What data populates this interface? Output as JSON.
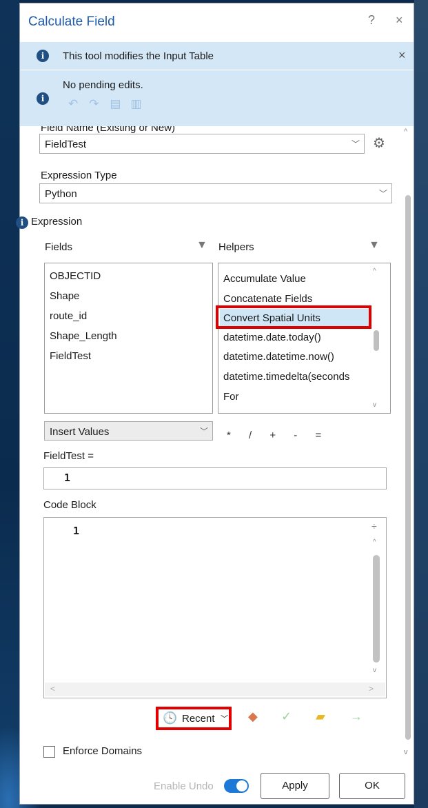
{
  "dialog": {
    "title": "Calculate Field",
    "help": "?",
    "close": "×"
  },
  "info": {
    "message": "This tool modifies the Input Table",
    "close": "×",
    "pending": "No pending edits."
  },
  "field_name": {
    "label": "Field Name (Existing or New)",
    "value": "FieldTest"
  },
  "expression_type": {
    "label": "Expression Type",
    "value": "Python"
  },
  "expression": {
    "label": "Expression",
    "fields_label": "Fields",
    "helpers_label": "Helpers",
    "fields": [
      "OBJECTID",
      "Shape",
      "route_id",
      "Shape_Length",
      "FieldTest"
    ],
    "helpers": [
      "Accumulate Value",
      "Concatenate Fields",
      "Convert Spatial Units",
      "datetime.date.today()",
      "datetime.datetime.now()",
      "datetime.timedelta(seconds",
      "For"
    ],
    "insert_values": "Insert Values",
    "operators": [
      "*",
      "/",
      "+",
      "-",
      "="
    ],
    "target": "FieldTest =",
    "line_number": "1"
  },
  "code_block": {
    "label": "Code Block",
    "line_number": "1"
  },
  "toolbar": {
    "recent": "Recent"
  },
  "enforce_domains": {
    "label": "Enforce Domains"
  },
  "footer": {
    "enable_undo": "Enable Undo",
    "apply": "Apply",
    "ok": "OK"
  },
  "colors": {
    "accent": "#1e5aa8",
    "info_band": "#d4e7f6",
    "highlight": "#e00000",
    "selection": "#cfe6f7"
  },
  "icons": [
    "info-icon",
    "undo-icon",
    "redo-icon",
    "save-edits-icon",
    "discard-edits-icon",
    "gear-icon",
    "filter-icon",
    "clock-icon",
    "eraser-icon",
    "checkmark-icon",
    "folder-icon",
    "arrow-right-icon"
  ]
}
